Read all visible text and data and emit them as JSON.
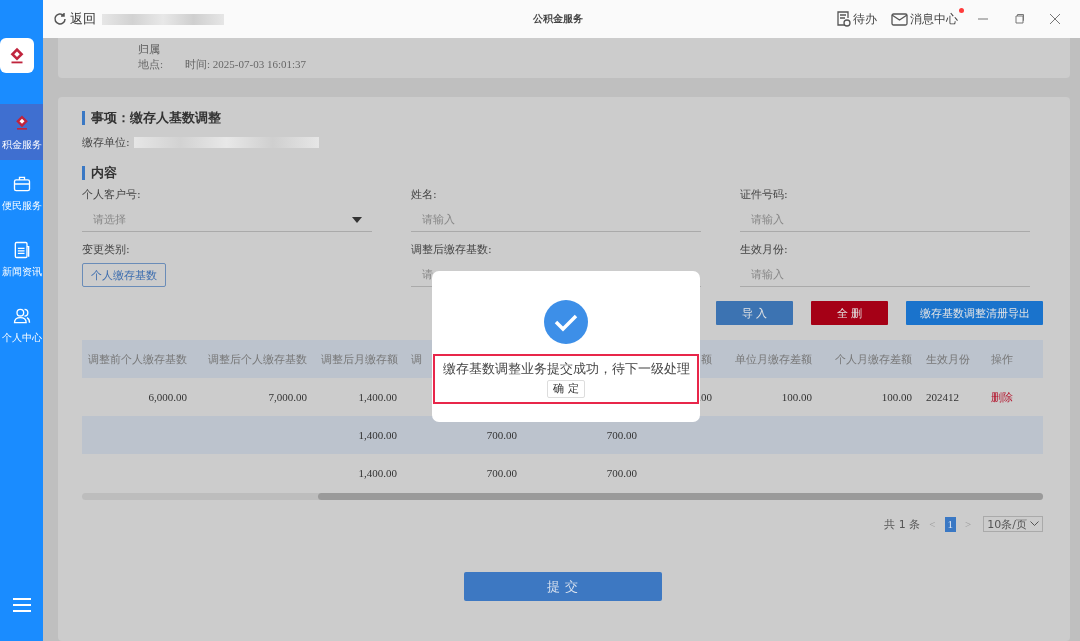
{
  "sidebar": {
    "items": [
      {
        "label": "积金服务",
        "selected": true
      },
      {
        "label": "便民服务",
        "selected": false
      },
      {
        "label": "新闻资讯",
        "selected": false
      },
      {
        "label": "个人中心",
        "selected": false
      }
    ]
  },
  "titlebar": {
    "back": "返回",
    "title": "公积金服务",
    "todo": "待办",
    "messages": "消息中心",
    "message_unread": true
  },
  "record": {
    "heading": "归属",
    "place_label": "地点:",
    "time": "时间: 2025-07-03 16:01:37"
  },
  "matter": {
    "title": "事项：缴存人基数调整",
    "unit_label": "缴存单位:"
  },
  "content": {
    "title": "内容",
    "fields": [
      {
        "label": "个人客户号:",
        "kind": "select",
        "placeholder": "请选择"
      },
      {
        "label": "姓名:",
        "kind": "input",
        "placeholder": "请输入"
      },
      {
        "label": "证件号码:",
        "kind": "input",
        "placeholder": "请输入"
      },
      {
        "label": "变更类别:",
        "kind": "tag",
        "value": "个人缴存基数"
      },
      {
        "label": "调整后缴存基数:",
        "kind": "input",
        "placeholder": "请"
      },
      {
        "label": "生效月份:",
        "kind": "input",
        "placeholder": "请输入"
      }
    ]
  },
  "actions": [
    {
      "label": "导 入",
      "kind": "primary"
    },
    {
      "label": "全 删",
      "kind": "danger"
    },
    {
      "label": "缴存基数调整清册导出",
      "kind": "export"
    }
  ],
  "table": {
    "columns": [
      {
        "label": "调整前个人缴存基数"
      },
      {
        "label": "调整后个人缴存基数"
      },
      {
        "label": "调整后月缴存额"
      },
      {
        "label": "调"
      },
      {},
      {
        "label": "额"
      },
      {
        "label": "单位月缴存差额"
      },
      {
        "label": "个人月缴存差额"
      },
      {
        "label": "生效月份"
      },
      {
        "label": "操作"
      }
    ],
    "rows": [
      {
        "striped": false,
        "cells": [
          "6,000.00",
          "7,000.00",
          "1,400.00",
          null,
          null,
          ".00",
          "100.00",
          "100.00",
          "202412",
          {
            "link": "删除"
          }
        ]
      },
      {
        "striped": true,
        "cells": [
          null,
          null,
          "1,400.00",
          "700.00",
          "700.00",
          null,
          null,
          null,
          null,
          null
        ]
      },
      {
        "striped": false,
        "cells": [
          null,
          null,
          "1,400.00",
          "700.00",
          "700.00",
          null,
          null,
          null,
          null,
          null
        ]
      }
    ]
  },
  "pagination": {
    "total": "共 1 条",
    "prev": "<",
    "pages": [
      {
        "label": "1",
        "selected": true
      }
    ],
    "next": ">",
    "page_size": "10条/页"
  },
  "submit": "提 交",
  "dialog": {
    "message": "缴存基数调整业务提交成功，待下一级处理",
    "confirm": "确 定"
  }
}
